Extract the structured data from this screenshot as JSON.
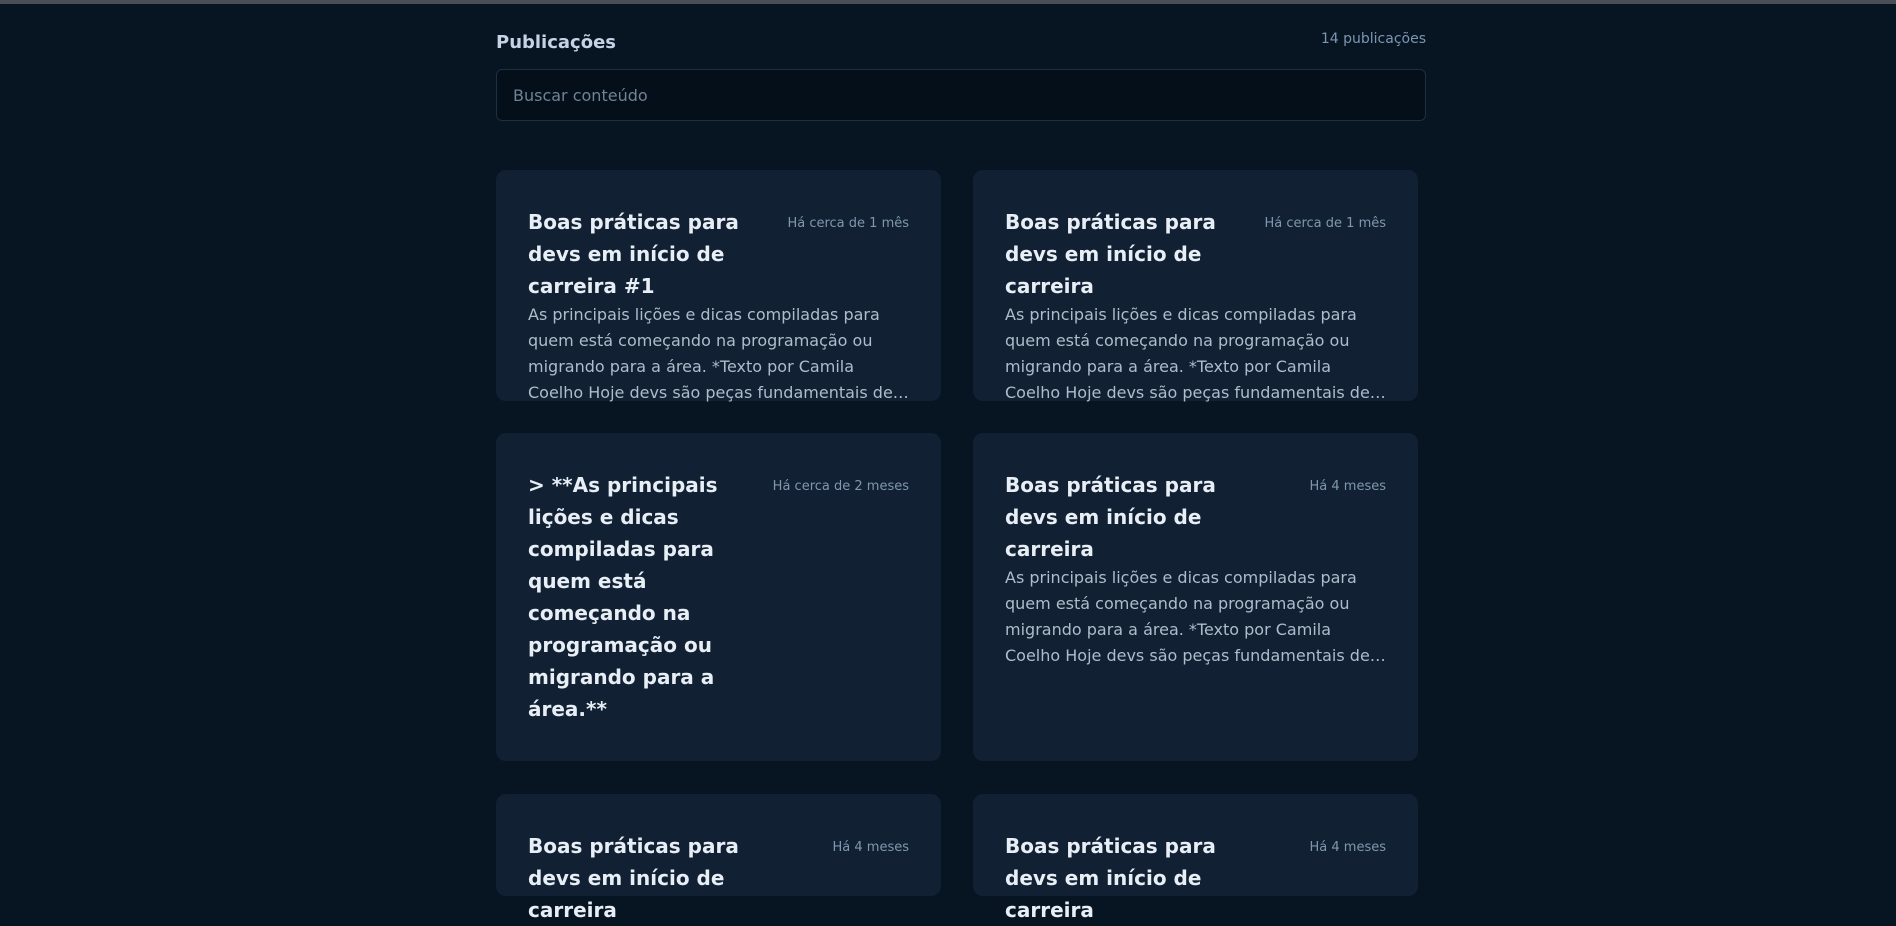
{
  "header": {
    "title": "Publicações",
    "count": "14 publicações"
  },
  "search": {
    "placeholder": "Buscar conteúdo",
    "value": ""
  },
  "posts": [
    {
      "title": "Boas práticas para devs em início de carreira #1",
      "time": "Há cerca de 1 mês",
      "excerpt": "As principais lições e dicas compiladas para quem está começando na programação ou migrando para a área. *Texto por Camila Coelho Hoje devs são peças fundamentais de todo negócio, estão nas…"
    },
    {
      "title": "Boas práticas para devs em início de carreira",
      "time": "Há cerca de 1 mês",
      "excerpt": "As principais lições e dicas compiladas para quem está começando na programação ou migrando para a área. *Texto por Camila Coelho Hoje devs são peças fundamentais de todo negócio, estão nas…"
    },
    {
      "title": "> **As principais lições e dicas compiladas para quem está começando na programação ou migrando para a área.**",
      "time": "Há cerca de 2 meses",
      "excerpt": ""
    },
    {
      "title": "Boas práticas para devs em início de carreira",
      "time": "Há 4 meses",
      "excerpt": "As principais lições e dicas compiladas para quem está começando na programação ou migrando para a área. *Texto por Camila Coelho Hoje devs são peças fundamentais de todo negócio, estão nas…"
    },
    {
      "title": "Boas práticas para devs em início de carreira",
      "time": "Há 4 meses",
      "excerpt": ""
    },
    {
      "title": "Boas práticas para devs em início de carreira",
      "time": "Há 4 meses",
      "excerpt": ""
    }
  ],
  "colors": {
    "background": "#071422",
    "card": "#112133",
    "title": "#e8eef5",
    "muted": "#7f97ad"
  }
}
